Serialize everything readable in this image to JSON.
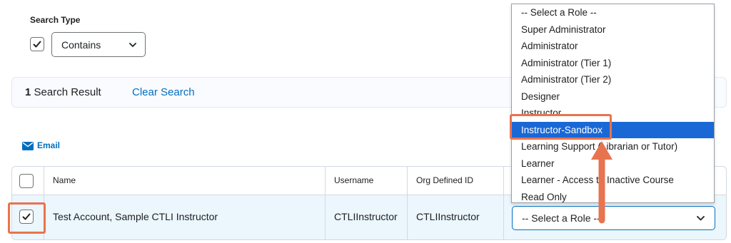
{
  "search_type": {
    "label": "Search Type",
    "checked": true,
    "select_value": "Contains"
  },
  "results": {
    "count": "1",
    "count_suffix": " Search Result",
    "clear_label": "Clear Search"
  },
  "email_label": "Email",
  "table": {
    "columns": [
      "Name",
      "Username",
      "Org Defined ID"
    ],
    "rows": [
      {
        "name": "Test Account, Sample CTLI Instructor",
        "username": "CTLIInstructor",
        "org_id": "CTLIInstructor",
        "role_value": "-- Select a Role --",
        "checked": true
      }
    ]
  },
  "role_dropdown": {
    "options": [
      "-- Select a Role --",
      "Super Administrator",
      "Administrator",
      "Administrator (Tier 1)",
      "Administrator (Tier 2)",
      "Designer",
      "Instructor",
      "Instructor-Sandbox",
      "Learning Support (Librarian or Tutor)",
      "Learner",
      "Learner - Access to Inactive Course",
      "Read Only"
    ],
    "highlighted_index": 7
  },
  "colors": {
    "link": "#006fbf",
    "selected_option": "#1a68d6",
    "annotation": "#e8734f",
    "row_selected": "#ebf6fd"
  }
}
